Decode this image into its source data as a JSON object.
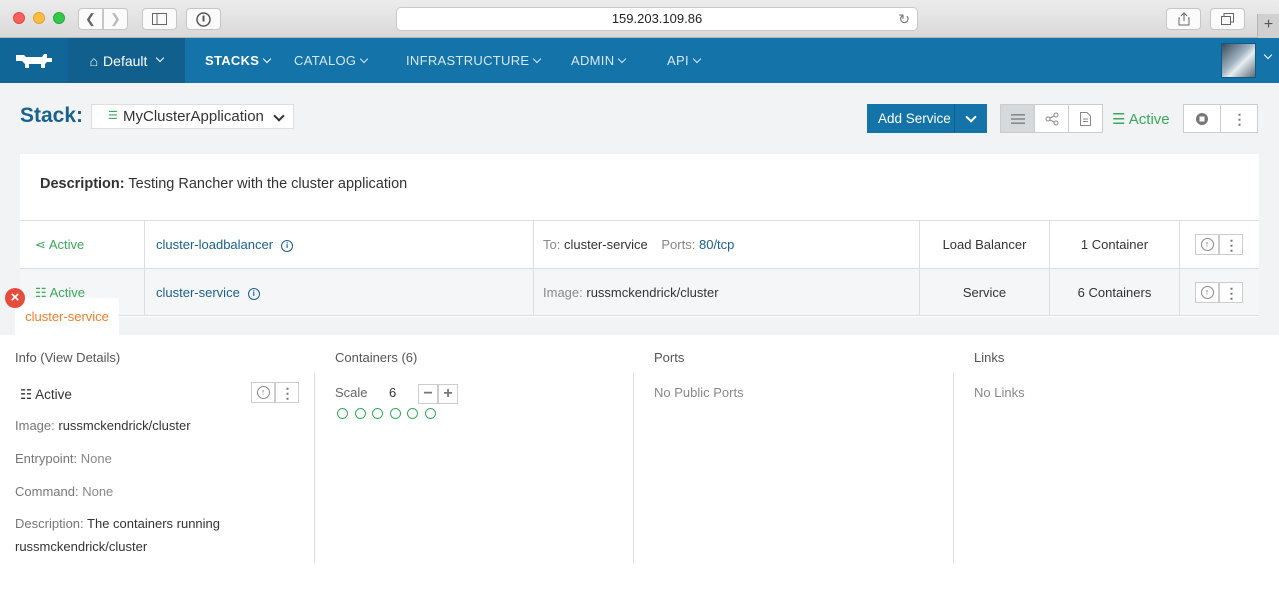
{
  "browser": {
    "url": "159.203.109.86"
  },
  "nav": {
    "environment": "Default",
    "items": [
      "STACKS",
      "CATALOG",
      "INFRASTRUCTURE",
      "ADMIN",
      "API"
    ]
  },
  "stack": {
    "label": "Stack:",
    "name": "MyClusterApplication",
    "add_service_label": "Add Service",
    "state": "Active",
    "description_label": "Description:",
    "description": "Testing Rancher with the cluster application"
  },
  "services": [
    {
      "state": "Active",
      "name": "cluster-loadbalancer",
      "detail_key1": "To:",
      "detail_val1": "cluster-service",
      "detail_key2": "Ports:",
      "detail_val2": "80/tcp",
      "type": "Load Balancer",
      "count": "1 Container"
    },
    {
      "state": "Active",
      "name": "cluster-service",
      "detail_key1": "Image:",
      "detail_val1": "russmckendrick/cluster",
      "type": "Service",
      "count": "6 Containers"
    }
  ],
  "detail": {
    "tab_label": "cluster-service",
    "info_heading": "Info (",
    "info_heading_end": ")",
    "view_details": "View Details",
    "state": "Active",
    "image_key": "Image:",
    "image_val": "russmckendrick/cluster",
    "entrypoint_key": "Entrypoint:",
    "entrypoint_val": "None",
    "command_key": "Command:",
    "command_val": "None",
    "description_key": "Description:",
    "description_val": "The containers running russmckendrick/cluster",
    "containers_heading": "Containers (6)",
    "scale_label": "Scale",
    "scale_value": "6",
    "container_count": 6,
    "ports_heading": "Ports",
    "ports_value": "No Public Ports",
    "links_heading": "Links",
    "links_value": "No Links"
  },
  "colors": {
    "nav_bg": "#1473a8",
    "active_green": "#3aa85b",
    "link_blue": "#1a618e",
    "tab_orange": "#f07c2a"
  }
}
